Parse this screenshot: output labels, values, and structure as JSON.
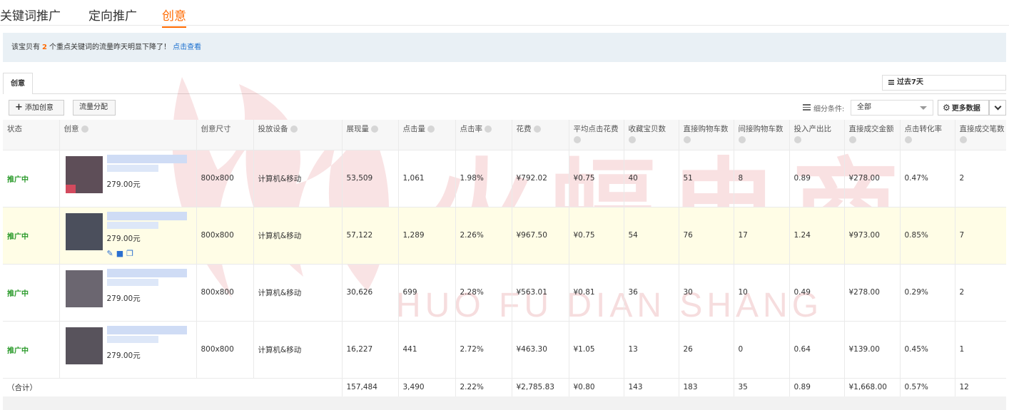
{
  "top_tabs": [
    {
      "label": "关键词推广"
    },
    {
      "label": "定向推广"
    },
    {
      "label": "创意",
      "active": true
    }
  ],
  "notice": {
    "prefix": "该宝贝有",
    "count": "2",
    "suffix": "个重点关键词的流量昨天明显下降了！",
    "link": "点击查看"
  },
  "sub_tab": "创意",
  "date_range": "过去7天",
  "toolbar": {
    "add_label": "添加创意",
    "flow_label": "流量分配",
    "filter_label": "细分条件:",
    "filter_value": "全部",
    "more_label": "更多数据"
  },
  "table": {
    "headers": [
      {
        "l1": "状态",
        "help": false
      },
      {
        "l1": "创意",
        "help": true
      },
      {
        "l1": "创意尺寸",
        "help": false
      },
      {
        "l1": "投放设备",
        "help": true
      },
      {
        "l1": "展现量",
        "help": true
      },
      {
        "l1": "点击量",
        "help": true
      },
      {
        "l1": "点击率",
        "help": true
      },
      {
        "l1": "花费",
        "help": true
      },
      {
        "l1": "平均点击花费",
        "help": true
      },
      {
        "l1": "收藏宝贝数",
        "help": true
      },
      {
        "l1": "直接购物车数",
        "help": true
      },
      {
        "l1": "间接购物车数",
        "help": true
      },
      {
        "l1": "投入产出比",
        "help": true
      },
      {
        "l1": "直接成交金额",
        "help": true
      },
      {
        "l1": "点击转化率",
        "help": true
      },
      {
        "l1": "直接成交笔数",
        "help": true
      }
    ],
    "rows": [
      {
        "status": "推广中",
        "price": "279.00元",
        "size": "800x800",
        "device": "计算机&移动",
        "impressions": "53,509",
        "clicks": "1,061",
        "ctr": "1.98%",
        "cost": "¥792.02",
        "cpc": "¥0.75",
        "favorites": "40",
        "direct_cart": "51",
        "indirect_cart": "8",
        "roi": "0.89",
        "direct_amount": "¥278.00",
        "cvr": "0.47%",
        "direct_orders": "2"
      },
      {
        "status": "推广中",
        "price": "279.00元",
        "size": "800x800",
        "device": "计算机&移动",
        "impressions": "57,122",
        "clicks": "1,289",
        "ctr": "2.26%",
        "cost": "¥967.50",
        "cpc": "¥0.75",
        "favorites": "54",
        "direct_cart": "76",
        "indirect_cart": "17",
        "roi": "1.24",
        "direct_amount": "¥973.00",
        "cvr": "0.85%",
        "direct_orders": "7"
      },
      {
        "status": "推广中",
        "price": "279.00元",
        "size": "800x800",
        "device": "计算机&移动",
        "impressions": "30,626",
        "clicks": "699",
        "ctr": "2.28%",
        "cost": "¥563.01",
        "cpc": "¥0.81",
        "favorites": "36",
        "direct_cart": "30",
        "indirect_cart": "10",
        "roi": "0.49",
        "direct_amount": "¥278.00",
        "cvr": "0.29%",
        "direct_orders": "2"
      },
      {
        "status": "推广中",
        "price": "279.00元",
        "size": "800x800",
        "device": "计算机&移动",
        "impressions": "16,227",
        "clicks": "441",
        "ctr": "2.72%",
        "cost": "¥463.30",
        "cpc": "¥1.05",
        "favorites": "13",
        "direct_cart": "26",
        "indirect_cart": "0",
        "roi": "0.64",
        "direct_amount": "¥139.00",
        "cvr": "0.45%",
        "direct_orders": "1"
      }
    ],
    "total": {
      "label": "（合计）",
      "impressions": "157,484",
      "clicks": "3,490",
      "ctr": "2.22%",
      "cost": "¥2,785.83",
      "cpc": "¥0.80",
      "favorites": "143",
      "direct_cart": "183",
      "indirect_cart": "35",
      "roi": "0.89",
      "direct_amount": "¥1,668.00",
      "cvr": "0.57%",
      "direct_orders": "12"
    }
  },
  "watermark": {
    "cn": "火蝠电商",
    "en": "HUO FU DIAN SHANG"
  },
  "colors": {
    "accent": "#ff6a00",
    "status": "#2a9a2a",
    "link": "#1a6fcf",
    "highlight_row": "#fffde6",
    "notice_bg": "#e9f0f5",
    "watermark": "#d4202c"
  }
}
